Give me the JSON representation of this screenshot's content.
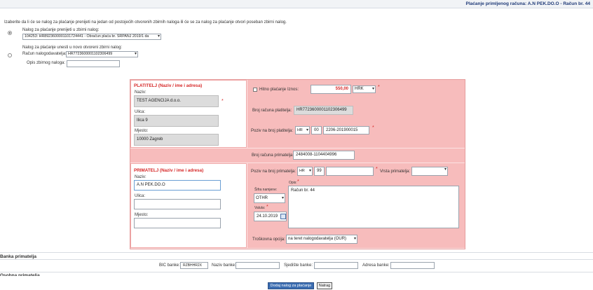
{
  "header": {
    "title": "Plaćanje primljenog računa: A.N PEK.DO.O - Račun br. 44"
  },
  "intro": {
    "text": "Izaberite da li će se nalog za plaćanje prenijeti na jedan od postojećih otvorenih zbirnih naloga ili će se za nalog za plaćanje otvori poseban zbirni nalog."
  },
  "option1": {
    "label": "Nalog za plaćanje prenijeti u zbirni nalog:",
    "select_value": "104253: HR8923600001101724441 - Obračun plaća br. SRPANJ 2019/1 da"
  },
  "option2": {
    "label": "Nalog za plaćanje unesti u novo otvoreni zbirni nalog:",
    "account_label": "Račun nalogodavatelja:",
    "account_value": "HR7723600001102306499",
    "desc_label": "Opis zbirnog naloga:",
    "desc_value": ""
  },
  "payer": {
    "title": "PLATITELJ (Naziv / ime i adresa)",
    "name_label": "Naziv:",
    "name_value": "TEST AGENCIJA d.o.o.",
    "street_label": "Ulica:",
    "street_value": "Ilica 9",
    "city_label": "Mjesto:",
    "city_value": "10000 Zagreb",
    "urgent_label": "Hitno plaćanje",
    "amount_label": "Iznos:",
    "amount_value": "550,00",
    "currency": "HRK",
    "account_label": "Broj računa platitelja:",
    "account_value": "HR7723600001102306499",
    "ref_label": "Poziv na broj platitelja:",
    "ref_country": "HR",
    "ref_model": "00",
    "ref_number": "2206-201900015"
  },
  "recipient_account": {
    "label": "Broj računa primatelja:",
    "value": "2484008-1104404996"
  },
  "recipient": {
    "title": "PRIMATELJ (Naziv / ime i adresa)",
    "name_label": "Naziv:",
    "name_value": "A.N PEK.DO.O",
    "street_label": "Ulica:",
    "street_value": "",
    "city_label": "Mjesto:",
    "city_value": "",
    "ref_label": "Poziv na broj primatelja:",
    "ref_country": "HR",
    "ref_model": "99",
    "ref_number": "",
    "type_label": "Vrsta primatelja:",
    "type_value": "",
    "purpose_label": "Šifra namjene:",
    "purpose_value": "OTHR",
    "desc_label": "Opis:",
    "desc_value": "Račun br. 44",
    "date_label": "Valuta:",
    "date_value": "24.10.2019",
    "fee_label": "Troškovna opcija:",
    "fee_value": "na teret nalogodavatelja (OUR)"
  },
  "bank": {
    "title": "Banka primatelja",
    "bic_label": "BIC banke:",
    "bic_value": "RZBHHR2X",
    "name_label": "Naziv banke:",
    "seat_label": "Sjedište banke:",
    "address_label": "Adresa banke:"
  },
  "other_section": {
    "title": "Osobna primatelja"
  },
  "buttons": {
    "submit": "Dodaj nalog za plaćanje",
    "back": "Natrag"
  }
}
